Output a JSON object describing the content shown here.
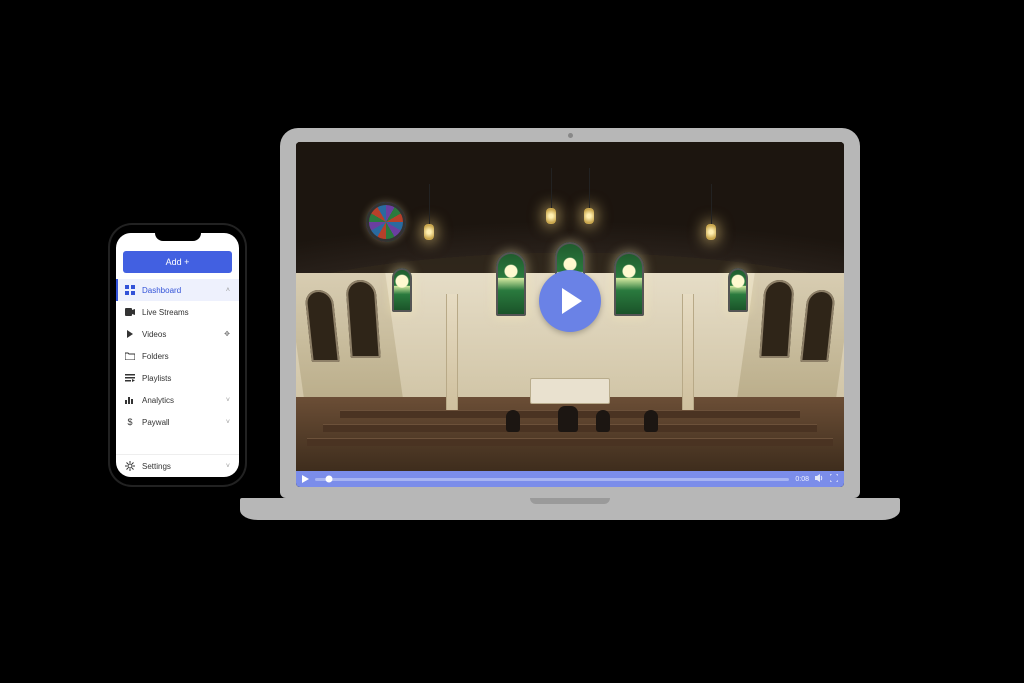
{
  "phone": {
    "add_label": "Add +",
    "nav": {
      "dashboard": "Dashboard",
      "live_streams": "Live Streams",
      "videos": "Videos",
      "folders": "Folders",
      "playlists": "Playlists",
      "analytics": "Analytics",
      "paywall": "Paywall",
      "settings": "Settings"
    }
  },
  "player": {
    "time": "0:08"
  }
}
